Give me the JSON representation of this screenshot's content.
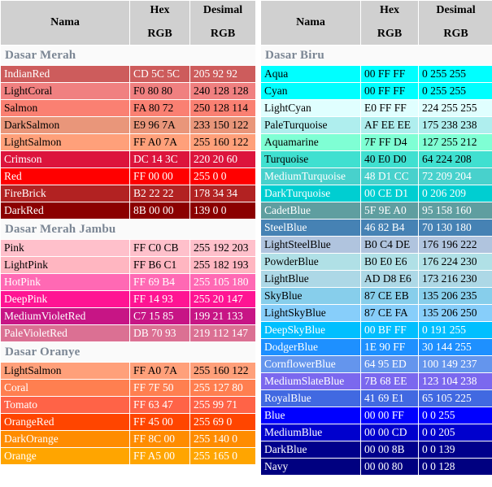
{
  "headers": {
    "name": "Nama",
    "hex_top": "Hex",
    "hex_bottom": "RGB",
    "dec_top": "Desimal",
    "dec_bottom": "RGB"
  },
  "palette": {
    "header_bg": "#d0d0d0",
    "section_bg": "#fafafa",
    "section_text": "#7b8694",
    "page_bg": "#ffffff"
  },
  "left_table": {
    "sections": [
      {
        "title": "Dasar Merah",
        "rows": [
          {
            "name": "IndianRed",
            "hex": "CD 5C 5C",
            "dec": "205 92 92",
            "bg": "#CD5C5C",
            "fg": "#ffffff"
          },
          {
            "name": "LightCoral",
            "hex": "F0 80 80",
            "dec": "240 128 128",
            "bg": "#F08080",
            "fg": "#000000"
          },
          {
            "name": "Salmon",
            "hex": "FA 80 72",
            "dec": "250 128 114",
            "bg": "#FA8072",
            "fg": "#000000"
          },
          {
            "name": "DarkSalmon",
            "hex": "E9 96 7A",
            "dec": "233 150 122",
            "bg": "#E9967A",
            "fg": "#000000"
          },
          {
            "name": "LightSalmon",
            "hex": "FF A0 7A",
            "dec": "255 160 122",
            "bg": "#FFA07A",
            "fg": "#000000"
          },
          {
            "name": "Crimson",
            "hex": "DC 14 3C",
            "dec": "220 20 60",
            "bg": "#DC143C",
            "fg": "#ffffff"
          },
          {
            "name": "Red",
            "hex": "FF 00 00",
            "dec": "255 0 0",
            "bg": "#FF0000",
            "fg": "#ffffff"
          },
          {
            "name": "FireBrick",
            "hex": "B2 22 22",
            "dec": "178 34 34",
            "bg": "#B22222",
            "fg": "#ffffff"
          },
          {
            "name": "DarkRed",
            "hex": "8B 00 00",
            "dec": "139 0 0",
            "bg": "#8B0000",
            "fg": "#ffffff"
          }
        ]
      },
      {
        "title": "Dasar Merah Jambu",
        "rows": [
          {
            "name": "Pink",
            "hex": "FF C0 CB",
            "dec": "255 192 203",
            "bg": "#FFC0CB",
            "fg": "#000000"
          },
          {
            "name": "LightPink",
            "hex": "FF B6 C1",
            "dec": "255 182 193",
            "bg": "#FFB6C1",
            "fg": "#000000"
          },
          {
            "name": "HotPink",
            "hex": "FF 69 B4",
            "dec": "255 105 180",
            "bg": "#FF69B4",
            "fg": "#ffffff"
          },
          {
            "name": "DeepPink",
            "hex": "FF 14 93",
            "dec": "255 20 147",
            "bg": "#FF1493",
            "fg": "#ffffff"
          },
          {
            "name": "MediumVioletRed",
            "hex": "C7 15 85",
            "dec": "199 21 133",
            "bg": "#C71585",
            "fg": "#ffffff"
          },
          {
            "name": "PaleVioletRed",
            "hex": "DB 70 93",
            "dec": "219 112 147",
            "bg": "#DB7093",
            "fg": "#ffffff"
          }
        ]
      },
      {
        "title": "Dasar Oranye",
        "rows": [
          {
            "name": "LightSalmon",
            "hex": "FF A0 7A",
            "dec": "255 160 122",
            "bg": "#FFA07A",
            "fg": "#000000"
          },
          {
            "name": "Coral",
            "hex": "FF 7F 50",
            "dec": "255 127 80",
            "bg": "#FF7F50",
            "fg": "#ffffff"
          },
          {
            "name": "Tomato",
            "hex": "FF 63 47",
            "dec": "255 99 71",
            "bg": "#FF6347",
            "fg": "#ffffff"
          },
          {
            "name": "OrangeRed",
            "hex": "FF 45 00",
            "dec": "255 69 0",
            "bg": "#FF4500",
            "fg": "#ffffff"
          },
          {
            "name": "DarkOrange",
            "hex": "FF 8C 00",
            "dec": "255 140 0",
            "bg": "#FF8C00",
            "fg": "#ffffff"
          },
          {
            "name": "Orange",
            "hex": "FF A5 00",
            "dec": "255 165 0",
            "bg": "#FFA500",
            "fg": "#ffffff"
          }
        ]
      }
    ]
  },
  "right_table": {
    "sections": [
      {
        "title": "Dasar Biru",
        "rows": [
          {
            "name": "Aqua",
            "hex": "00 FF FF",
            "dec": "0 255 255",
            "bg": "#00FFFF",
            "fg": "#000000"
          },
          {
            "name": "Cyan",
            "hex": "00 FF FF",
            "dec": "0 255 255",
            "bg": "#00FFFF",
            "fg": "#000000"
          },
          {
            "name": "LightCyan",
            "hex": "E0 FF FF",
            "dec": "224 255 255",
            "bg": "#E0FFFF",
            "fg": "#000000"
          },
          {
            "name": "PaleTurquoise",
            "hex": "AF EE EE",
            "dec": "175 238 238",
            "bg": "#AFEEEE",
            "fg": "#000000"
          },
          {
            "name": "Aquamarine",
            "hex": "7F FF D4",
            "dec": "127 255 212",
            "bg": "#7FFFD4",
            "fg": "#000000"
          },
          {
            "name": "Turquoise",
            "hex": "40 E0 D0",
            "dec": "64 224 208",
            "bg": "#40E0D0",
            "fg": "#000000"
          },
          {
            "name": "MediumTurquoise",
            "hex": "48 D1 CC",
            "dec": "72 209 204",
            "bg": "#48D1CC",
            "fg": "#ffffff"
          },
          {
            "name": "DarkTurquoise",
            "hex": "00 CE D1",
            "dec": "0 206 209",
            "bg": "#00CED1",
            "fg": "#ffffff"
          },
          {
            "name": "CadetBlue",
            "hex": "5F 9E A0",
            "dec": "95 158 160",
            "bg": "#5F9EA0",
            "fg": "#ffffff"
          },
          {
            "name": "SteelBlue",
            "hex": "46 82 B4",
            "dec": "70 130 180",
            "bg": "#4682B4",
            "fg": "#ffffff"
          },
          {
            "name": "LightSteelBlue",
            "hex": "B0 C4 DE",
            "dec": "176 196 222",
            "bg": "#B0C4DE",
            "fg": "#000000"
          },
          {
            "name": "PowderBlue",
            "hex": "B0 E0 E6",
            "dec": "176 224 230",
            "bg": "#B0E0E6",
            "fg": "#000000"
          },
          {
            "name": "LightBlue",
            "hex": "AD D8 E6",
            "dec": "173 216 230",
            "bg": "#ADD8E6",
            "fg": "#000000"
          },
          {
            "name": "SkyBlue",
            "hex": "87 CE EB",
            "dec": "135 206 235",
            "bg": "#87CEEB",
            "fg": "#000000"
          },
          {
            "name": "LightSkyBlue",
            "hex": "87 CE FA",
            "dec": "135 206 250",
            "bg": "#87CEFA",
            "fg": "#000000"
          },
          {
            "name": "DeepSkyBlue",
            "hex": "00 BF FF",
            "dec": "0 191 255",
            "bg": "#00BFFF",
            "fg": "#ffffff"
          },
          {
            "name": "DodgerBlue",
            "hex": "1E 90 FF",
            "dec": "30 144 255",
            "bg": "#1E90FF",
            "fg": "#ffffff"
          },
          {
            "name": "CornflowerBlue",
            "hex": "64 95 ED",
            "dec": "100 149 237",
            "bg": "#6495ED",
            "fg": "#ffffff"
          },
          {
            "name": "MediumSlateBlue",
            "hex": "7B 68 EE",
            "dec": "123 104 238",
            "bg": "#7B68EE",
            "fg": "#ffffff"
          },
          {
            "name": "RoyalBlue",
            "hex": "41 69 E1",
            "dec": "65 105 225",
            "bg": "#4169E1",
            "fg": "#ffffff"
          },
          {
            "name": "Blue",
            "hex": "00 00 FF",
            "dec": "0 0 255",
            "bg": "#0000FF",
            "fg": "#ffffff"
          },
          {
            "name": "MediumBlue",
            "hex": "00 00 CD",
            "dec": "0 0 205",
            "bg": "#0000CD",
            "fg": "#ffffff"
          },
          {
            "name": "DarkBlue",
            "hex": "00 00 8B",
            "dec": "0 0 139",
            "bg": "#00008B",
            "fg": "#ffffff"
          },
          {
            "name": "Navy",
            "hex": "00 00 80",
            "dec": "0 0 128",
            "bg": "#000080",
            "fg": "#ffffff"
          }
        ]
      }
    ]
  }
}
